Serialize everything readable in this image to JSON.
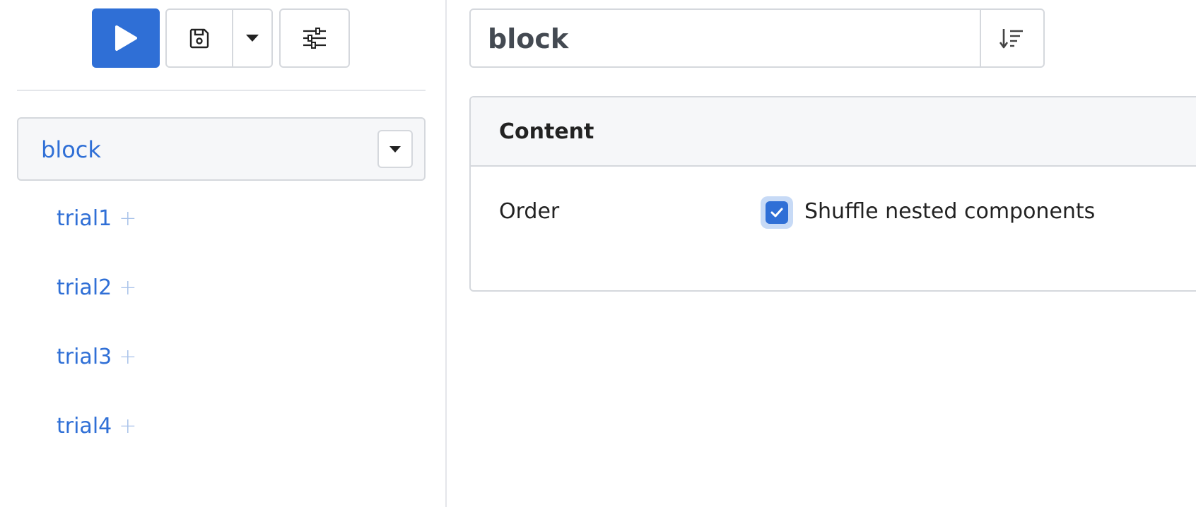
{
  "sidebar": {
    "toolbar": {
      "run_icon": "play-icon",
      "save_icon": "save-icon",
      "save_menu_icon": "caret-down-icon",
      "settings_icon": "sliders-icon"
    },
    "tree": {
      "root_label": "block",
      "items": [
        {
          "label": "trial1"
        },
        {
          "label": "trial2"
        },
        {
          "label": "trial3"
        },
        {
          "label": "trial4"
        }
      ],
      "add_symbol": "+"
    }
  },
  "header": {
    "title": "block",
    "sort_icon": "sort-descending-icon"
  },
  "panel": {
    "title": "Content",
    "rows": [
      {
        "label": "Order",
        "checkbox_label": "Shuffle nested components",
        "checked": true
      }
    ]
  },
  "colors": {
    "accent": "#2f6fd6",
    "border": "#d5d8dd",
    "header_bg": "#f6f7f9"
  }
}
